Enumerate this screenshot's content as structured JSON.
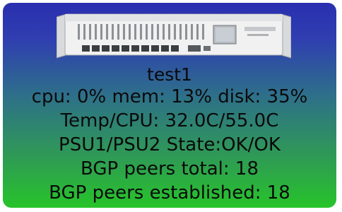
{
  "device": {
    "name": "test1",
    "image": "router-icon"
  },
  "stats": {
    "resources": "cpu: 0% mem: 13% disk: 35%",
    "temperature": "Temp/CPU: 32.0C/55.0C",
    "psu": "PSU1/PSU2 State:OK/OK",
    "bgp_total": "BGP peers total: 18",
    "bgp_established": "BGP peers established: 18"
  },
  "colors": {
    "gradient_top": "#2a2fb0",
    "gradient_bottom": "#27c42a",
    "text": "#0a0a0a"
  }
}
